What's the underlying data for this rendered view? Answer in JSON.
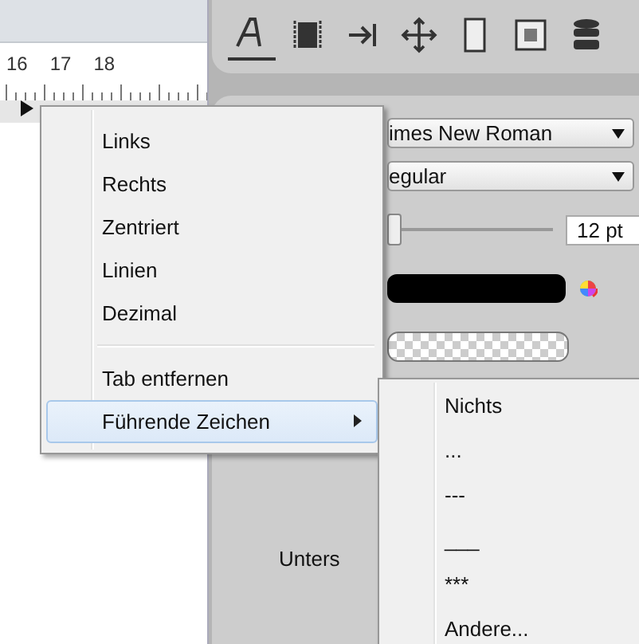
{
  "ruler": {
    "numbers": [
      "16",
      "17",
      "18"
    ]
  },
  "toolbar": {
    "buttons": [
      {
        "kind": "text",
        "selected": true
      },
      {
        "kind": "frame",
        "selected": false
      },
      {
        "kind": "tab",
        "selected": false
      },
      {
        "kind": "move",
        "selected": false
      },
      {
        "kind": "rect",
        "selected": false
      },
      {
        "kind": "pattern",
        "selected": false
      },
      {
        "kind": "database",
        "selected": false
      }
    ]
  },
  "properties": {
    "font": "imes New Roman",
    "style": "egular",
    "size_slider": {
      "level": 0.0
    },
    "size": "12 pt",
    "text_color": {
      "color": "#000000"
    },
    "label": "Unters"
  },
  "context_menu": {
    "items": [
      {
        "kind": "item",
        "label": "Links",
        "selected": false,
        "submenu": false
      },
      {
        "kind": "item",
        "label": "Rechts",
        "selected": false,
        "submenu": false
      },
      {
        "kind": "item",
        "label": "Zentriert",
        "selected": false,
        "submenu": false
      },
      {
        "kind": "item",
        "label": "Linien",
        "selected": false,
        "submenu": false
      },
      {
        "kind": "item",
        "label": "Dezimal",
        "selected": false,
        "submenu": false
      },
      {
        "kind": "separator"
      },
      {
        "kind": "item",
        "label": "Tab entfernen",
        "selected": false,
        "submenu": false
      },
      {
        "kind": "item",
        "label": "Führende Zeichen",
        "selected": true,
        "submenu": true
      }
    ]
  },
  "submenu": {
    "items": [
      {
        "label": "Nichts",
        "selected": false
      },
      {
        "label": "...",
        "selected": false
      },
      {
        "label": "---",
        "selected": false
      },
      {
        "label": "___",
        "selected": false
      },
      {
        "label": "***",
        "selected": false
      },
      {
        "label": "Andere...",
        "selected": false
      }
    ]
  }
}
